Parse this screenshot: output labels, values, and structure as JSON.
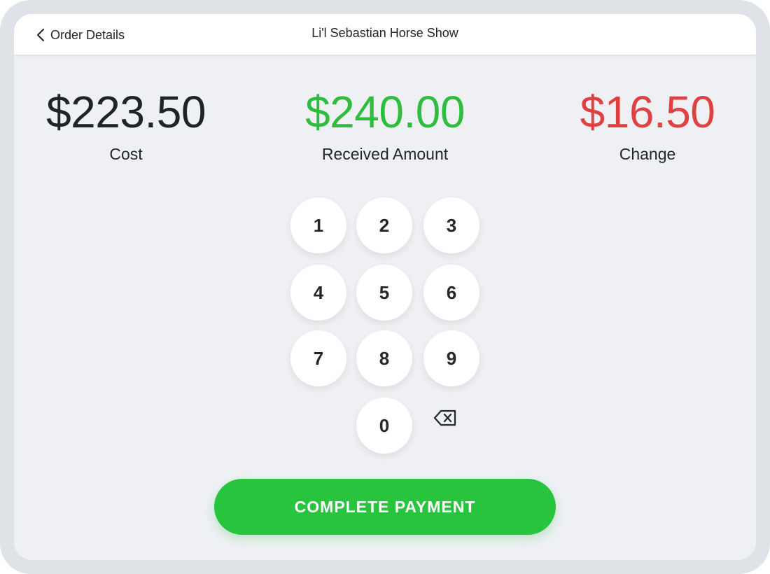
{
  "header": {
    "back_label": "Order Details",
    "title": "Li'l Sebastian Horse Show"
  },
  "amounts": {
    "cost": {
      "value": "$223.50",
      "label": "Cost",
      "color": "#202327"
    },
    "received": {
      "value": "$240.00",
      "label": "Received Amount",
      "color": "#2ebd3f"
    },
    "change": {
      "value": "$16.50",
      "label": "Change",
      "color": "#df4143"
    }
  },
  "keypad": {
    "keys": [
      "1",
      "2",
      "3",
      "4",
      "5",
      "6",
      "7",
      "8",
      "9",
      "0"
    ],
    "backspace_icon": "backspace-icon"
  },
  "action": {
    "label": "COMPLETE PAYMENT",
    "color": "#29c43e"
  }
}
